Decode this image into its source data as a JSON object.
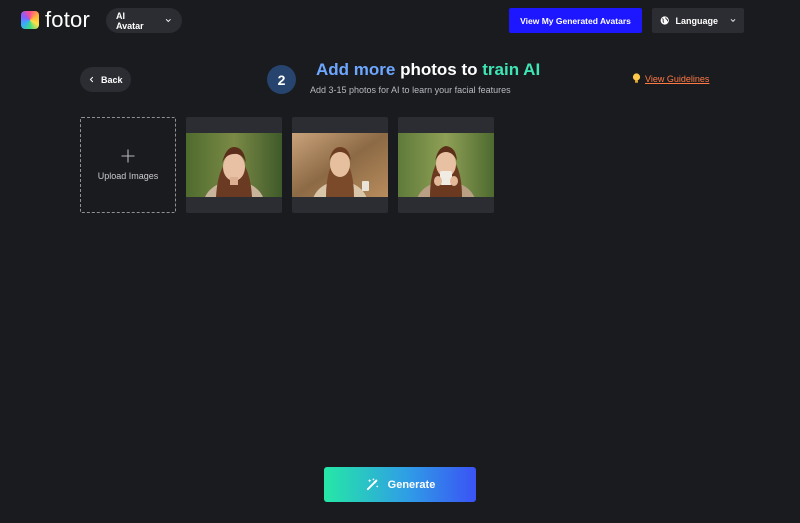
{
  "header": {
    "logo_text": "fotor",
    "product_select": "AI Avatar",
    "view_button": "View My Generated Avatars",
    "language_button": "Language"
  },
  "nav": {
    "back_label": "Back"
  },
  "step": {
    "number": "2",
    "title_part1": "Add more",
    "title_part2": "photos to",
    "title_part3": "train AI",
    "subtitle": "Add 3-15 photos for AI to learn your facial features",
    "guidelines_link": "View Guidelines"
  },
  "upload": {
    "label": "Upload Images"
  },
  "photos": [
    {
      "id": "photo-1"
    },
    {
      "id": "photo-2"
    },
    {
      "id": "photo-3"
    }
  ],
  "actions": {
    "generate_label": "Generate"
  },
  "colors": {
    "background": "#1a1b1f",
    "surface": "#2c2d32",
    "primary_blue": "#1c17ff",
    "step_badge": "#26446e",
    "title_blue": "#6ea7ff",
    "title_teal": "#3ee6b5",
    "link_orange": "#ff7a45",
    "generate_gradient_start": "#25e8a6",
    "generate_gradient_end": "#3a53f5"
  },
  "icons": {
    "logo": "fotor-logo-icon",
    "product_chevron": "chevron-down-icon",
    "globe": "globe-icon",
    "language_chevron": "chevron-down-icon",
    "back": "chevron-left-icon",
    "guidelines": "lightbulb-icon",
    "upload": "plus-icon",
    "generate": "magic-wand-icon"
  }
}
